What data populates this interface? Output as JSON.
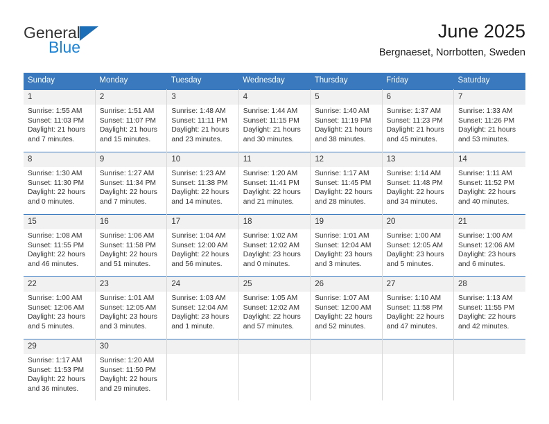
{
  "brand": {
    "name_top": "General",
    "name_bottom": "Blue",
    "accent_color": "#1c84d6",
    "logo_triangle_color": "#1c6fb6"
  },
  "header": {
    "title": "June 2025",
    "subtitle": "Bergnaeset, Norrbotten, Sweden"
  },
  "calendar": {
    "header_bg": "#3a79bd",
    "daynum_bg": "#f1f1f1",
    "weekday_headers": [
      "Sunday",
      "Monday",
      "Tuesday",
      "Wednesday",
      "Thursday",
      "Friday",
      "Saturday"
    ],
    "weeks": [
      [
        {
          "day": "1",
          "sunrise": "Sunrise: 1:55 AM",
          "sunset": "Sunset: 11:03 PM",
          "daylight_1": "Daylight: 21 hours",
          "daylight_2": "and 7 minutes."
        },
        {
          "day": "2",
          "sunrise": "Sunrise: 1:51 AM",
          "sunset": "Sunset: 11:07 PM",
          "daylight_1": "Daylight: 21 hours",
          "daylight_2": "and 15 minutes."
        },
        {
          "day": "3",
          "sunrise": "Sunrise: 1:48 AM",
          "sunset": "Sunset: 11:11 PM",
          "daylight_1": "Daylight: 21 hours",
          "daylight_2": "and 23 minutes."
        },
        {
          "day": "4",
          "sunrise": "Sunrise: 1:44 AM",
          "sunset": "Sunset: 11:15 PM",
          "daylight_1": "Daylight: 21 hours",
          "daylight_2": "and 30 minutes."
        },
        {
          "day": "5",
          "sunrise": "Sunrise: 1:40 AM",
          "sunset": "Sunset: 11:19 PM",
          "daylight_1": "Daylight: 21 hours",
          "daylight_2": "and 38 minutes."
        },
        {
          "day": "6",
          "sunrise": "Sunrise: 1:37 AM",
          "sunset": "Sunset: 11:23 PM",
          "daylight_1": "Daylight: 21 hours",
          "daylight_2": "and 45 minutes."
        },
        {
          "day": "7",
          "sunrise": "Sunrise: 1:33 AM",
          "sunset": "Sunset: 11:26 PM",
          "daylight_1": "Daylight: 21 hours",
          "daylight_2": "and 53 minutes."
        }
      ],
      [
        {
          "day": "8",
          "sunrise": "Sunrise: 1:30 AM",
          "sunset": "Sunset: 11:30 PM",
          "daylight_1": "Daylight: 22 hours",
          "daylight_2": "and 0 minutes."
        },
        {
          "day": "9",
          "sunrise": "Sunrise: 1:27 AM",
          "sunset": "Sunset: 11:34 PM",
          "daylight_1": "Daylight: 22 hours",
          "daylight_2": "and 7 minutes."
        },
        {
          "day": "10",
          "sunrise": "Sunrise: 1:23 AM",
          "sunset": "Sunset: 11:38 PM",
          "daylight_1": "Daylight: 22 hours",
          "daylight_2": "and 14 minutes."
        },
        {
          "day": "11",
          "sunrise": "Sunrise: 1:20 AM",
          "sunset": "Sunset: 11:41 PM",
          "daylight_1": "Daylight: 22 hours",
          "daylight_2": "and 21 minutes."
        },
        {
          "day": "12",
          "sunrise": "Sunrise: 1:17 AM",
          "sunset": "Sunset: 11:45 PM",
          "daylight_1": "Daylight: 22 hours",
          "daylight_2": "and 28 minutes."
        },
        {
          "day": "13",
          "sunrise": "Sunrise: 1:14 AM",
          "sunset": "Sunset: 11:48 PM",
          "daylight_1": "Daylight: 22 hours",
          "daylight_2": "and 34 minutes."
        },
        {
          "day": "14",
          "sunrise": "Sunrise: 1:11 AM",
          "sunset": "Sunset: 11:52 PM",
          "daylight_1": "Daylight: 22 hours",
          "daylight_2": "and 40 minutes."
        }
      ],
      [
        {
          "day": "15",
          "sunrise": "Sunrise: 1:08 AM",
          "sunset": "Sunset: 11:55 PM",
          "daylight_1": "Daylight: 22 hours",
          "daylight_2": "and 46 minutes."
        },
        {
          "day": "16",
          "sunrise": "Sunrise: 1:06 AM",
          "sunset": "Sunset: 11:58 PM",
          "daylight_1": "Daylight: 22 hours",
          "daylight_2": "and 51 minutes."
        },
        {
          "day": "17",
          "sunrise": "Sunrise: 1:04 AM",
          "sunset": "Sunset: 12:00 AM",
          "daylight_1": "Daylight: 22 hours",
          "daylight_2": "and 56 minutes."
        },
        {
          "day": "18",
          "sunrise": "Sunrise: 1:02 AM",
          "sunset": "Sunset: 12:02 AM",
          "daylight_1": "Daylight: 23 hours",
          "daylight_2": "and 0 minutes."
        },
        {
          "day": "19",
          "sunrise": "Sunrise: 1:01 AM",
          "sunset": "Sunset: 12:04 AM",
          "daylight_1": "Daylight: 23 hours",
          "daylight_2": "and 3 minutes."
        },
        {
          "day": "20",
          "sunrise": "Sunrise: 1:00 AM",
          "sunset": "Sunset: 12:05 AM",
          "daylight_1": "Daylight: 23 hours",
          "daylight_2": "and 5 minutes."
        },
        {
          "day": "21",
          "sunrise": "Sunrise: 1:00 AM",
          "sunset": "Sunset: 12:06 AM",
          "daylight_1": "Daylight: 23 hours",
          "daylight_2": "and 6 minutes."
        }
      ],
      [
        {
          "day": "22",
          "sunrise": "Sunrise: 1:00 AM",
          "sunset": "Sunset: 12:06 AM",
          "daylight_1": "Daylight: 23 hours",
          "daylight_2": "and 5 minutes."
        },
        {
          "day": "23",
          "sunrise": "Sunrise: 1:01 AM",
          "sunset": "Sunset: 12:05 AM",
          "daylight_1": "Daylight: 23 hours",
          "daylight_2": "and 3 minutes."
        },
        {
          "day": "24",
          "sunrise": "Sunrise: 1:03 AM",
          "sunset": "Sunset: 12:04 AM",
          "daylight_1": "Daylight: 23 hours",
          "daylight_2": "and 1 minute."
        },
        {
          "day": "25",
          "sunrise": "Sunrise: 1:05 AM",
          "sunset": "Sunset: 12:02 AM",
          "daylight_1": "Daylight: 22 hours",
          "daylight_2": "and 57 minutes."
        },
        {
          "day": "26",
          "sunrise": "Sunrise: 1:07 AM",
          "sunset": "Sunset: 12:00 AM",
          "daylight_1": "Daylight: 22 hours",
          "daylight_2": "and 52 minutes."
        },
        {
          "day": "27",
          "sunrise": "Sunrise: 1:10 AM",
          "sunset": "Sunset: 11:58 PM",
          "daylight_1": "Daylight: 22 hours",
          "daylight_2": "and 47 minutes."
        },
        {
          "day": "28",
          "sunrise": "Sunrise: 1:13 AM",
          "sunset": "Sunset: 11:55 PM",
          "daylight_1": "Daylight: 22 hours",
          "daylight_2": "and 42 minutes."
        }
      ],
      [
        {
          "day": "29",
          "sunrise": "Sunrise: 1:17 AM",
          "sunset": "Sunset: 11:53 PM",
          "daylight_1": "Daylight: 22 hours",
          "daylight_2": "and 36 minutes."
        },
        {
          "day": "30",
          "sunrise": "Sunrise: 1:20 AM",
          "sunset": "Sunset: 11:50 PM",
          "daylight_1": "Daylight: 22 hours",
          "daylight_2": "and 29 minutes."
        },
        {
          "day": "",
          "sunrise": "",
          "sunset": "",
          "daylight_1": "",
          "daylight_2": ""
        },
        {
          "day": "",
          "sunrise": "",
          "sunset": "",
          "daylight_1": "",
          "daylight_2": ""
        },
        {
          "day": "",
          "sunrise": "",
          "sunset": "",
          "daylight_1": "",
          "daylight_2": ""
        },
        {
          "day": "",
          "sunrise": "",
          "sunset": "",
          "daylight_1": "",
          "daylight_2": ""
        },
        {
          "day": "",
          "sunrise": "",
          "sunset": "",
          "daylight_1": "",
          "daylight_2": ""
        }
      ]
    ]
  }
}
